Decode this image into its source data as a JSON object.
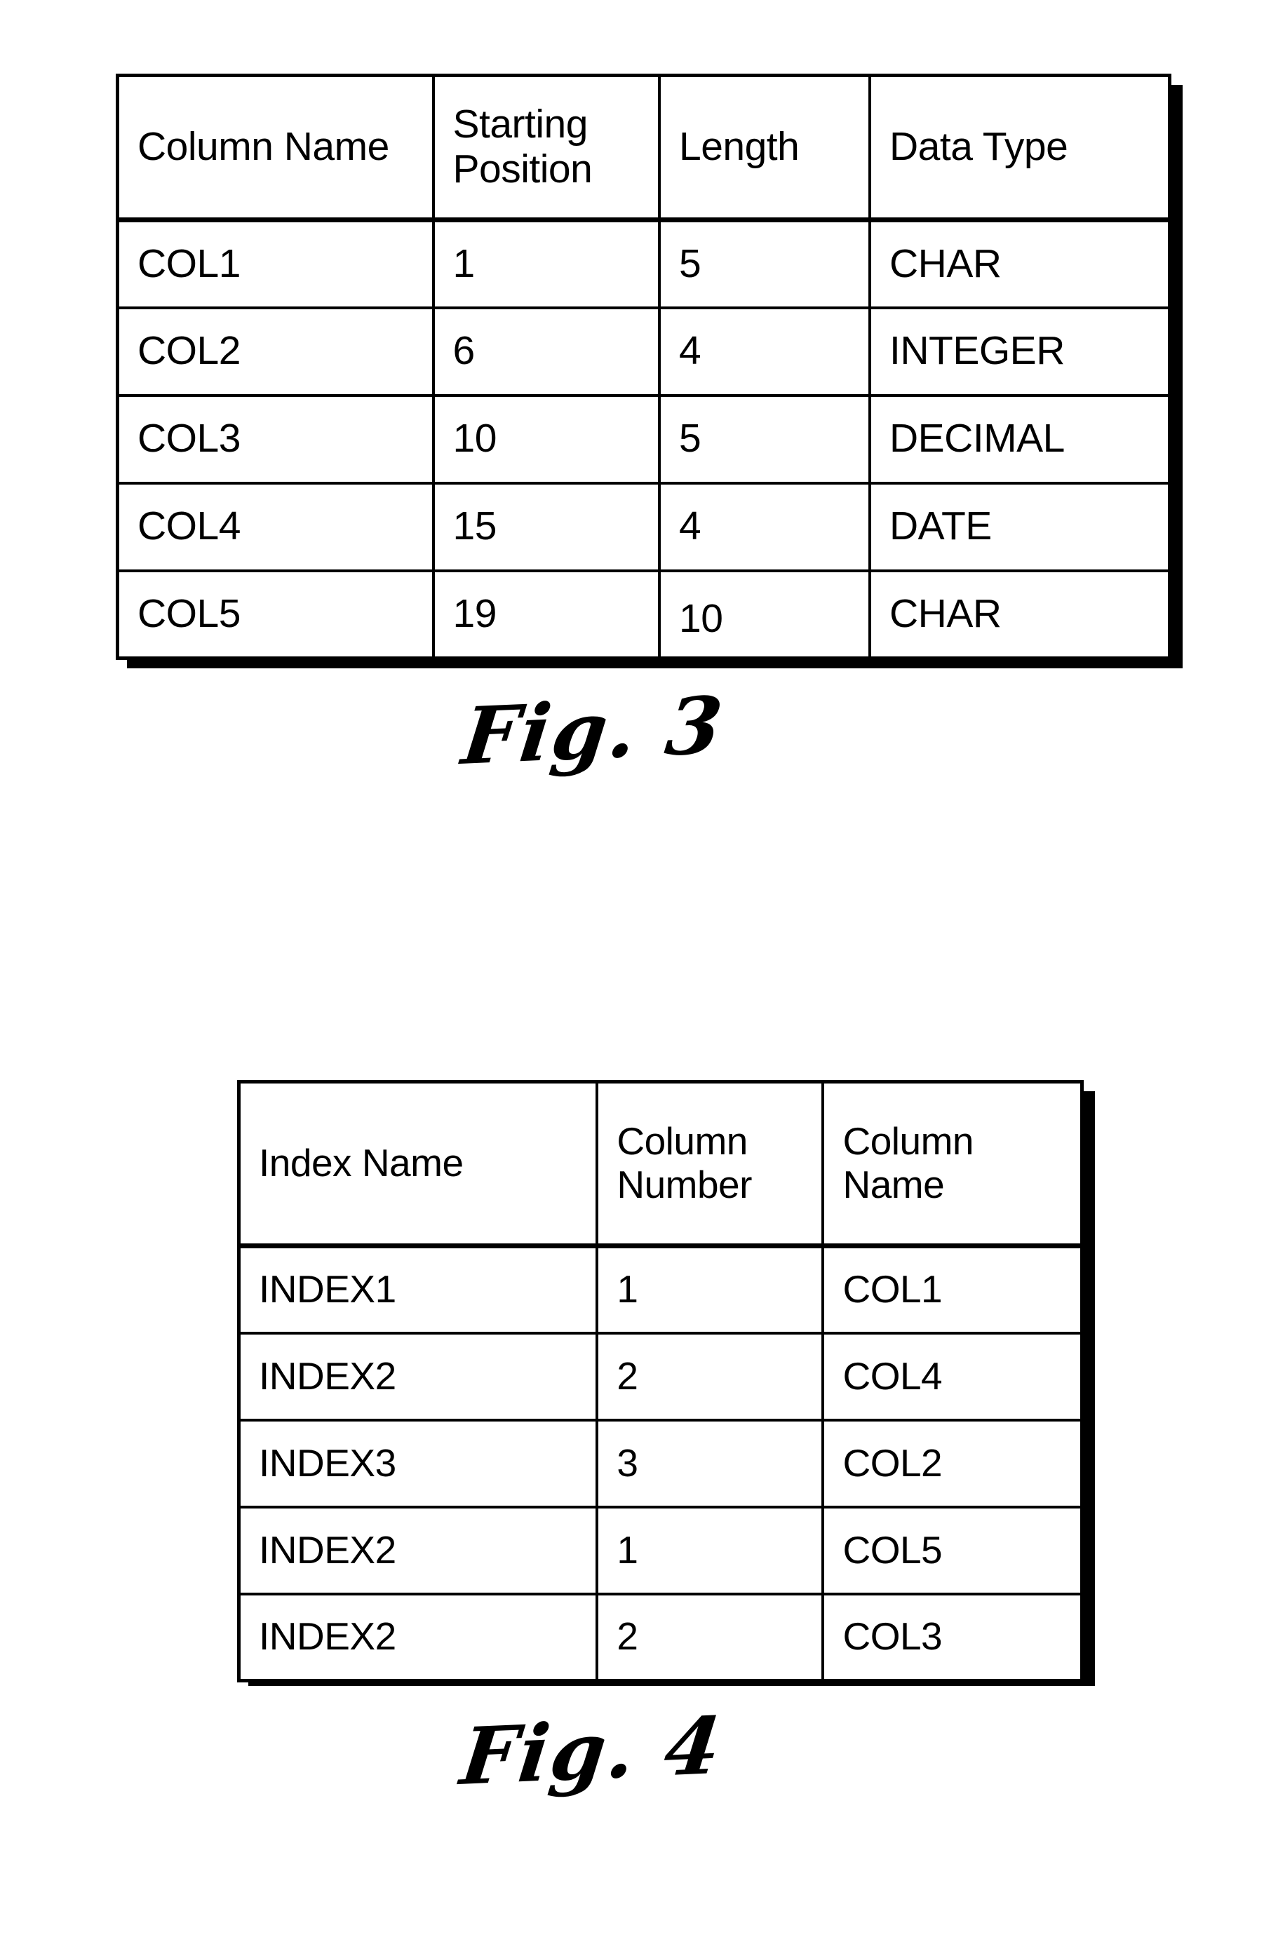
{
  "page": {
    "background_color": "#ffffff",
    "ink_color": "#000000"
  },
  "figures": [
    {
      "id": "fig3",
      "caption": "Fig. 3",
      "table": {
        "headers": [
          "Column Name",
          "Starting Position",
          "Length",
          "Data Type"
        ],
        "rows": [
          [
            "COL1",
            "1",
            "5",
            "CHAR"
          ],
          [
            "COL2",
            "6",
            "4",
            "INTEGER"
          ],
          [
            "COL3",
            "10",
            "5",
            "DECIMAL"
          ],
          [
            "COL4",
            "15",
            "4",
            "DATE"
          ],
          [
            "COL5",
            "19",
            "10",
            "CHAR"
          ]
        ]
      }
    },
    {
      "id": "fig4",
      "caption": "Fig. 4",
      "table": {
        "headers": [
          "Index Name",
          "Column Number",
          "Column Name"
        ],
        "rows": [
          [
            "INDEX1",
            "1",
            "COL1"
          ],
          [
            "INDEX2",
            "2",
            "COL4"
          ],
          [
            "INDEX3",
            "3",
            "COL2"
          ],
          [
            "INDEX2",
            "1",
            "COL5"
          ],
          [
            "INDEX2",
            "2",
            "COL3"
          ]
        ]
      }
    }
  ]
}
